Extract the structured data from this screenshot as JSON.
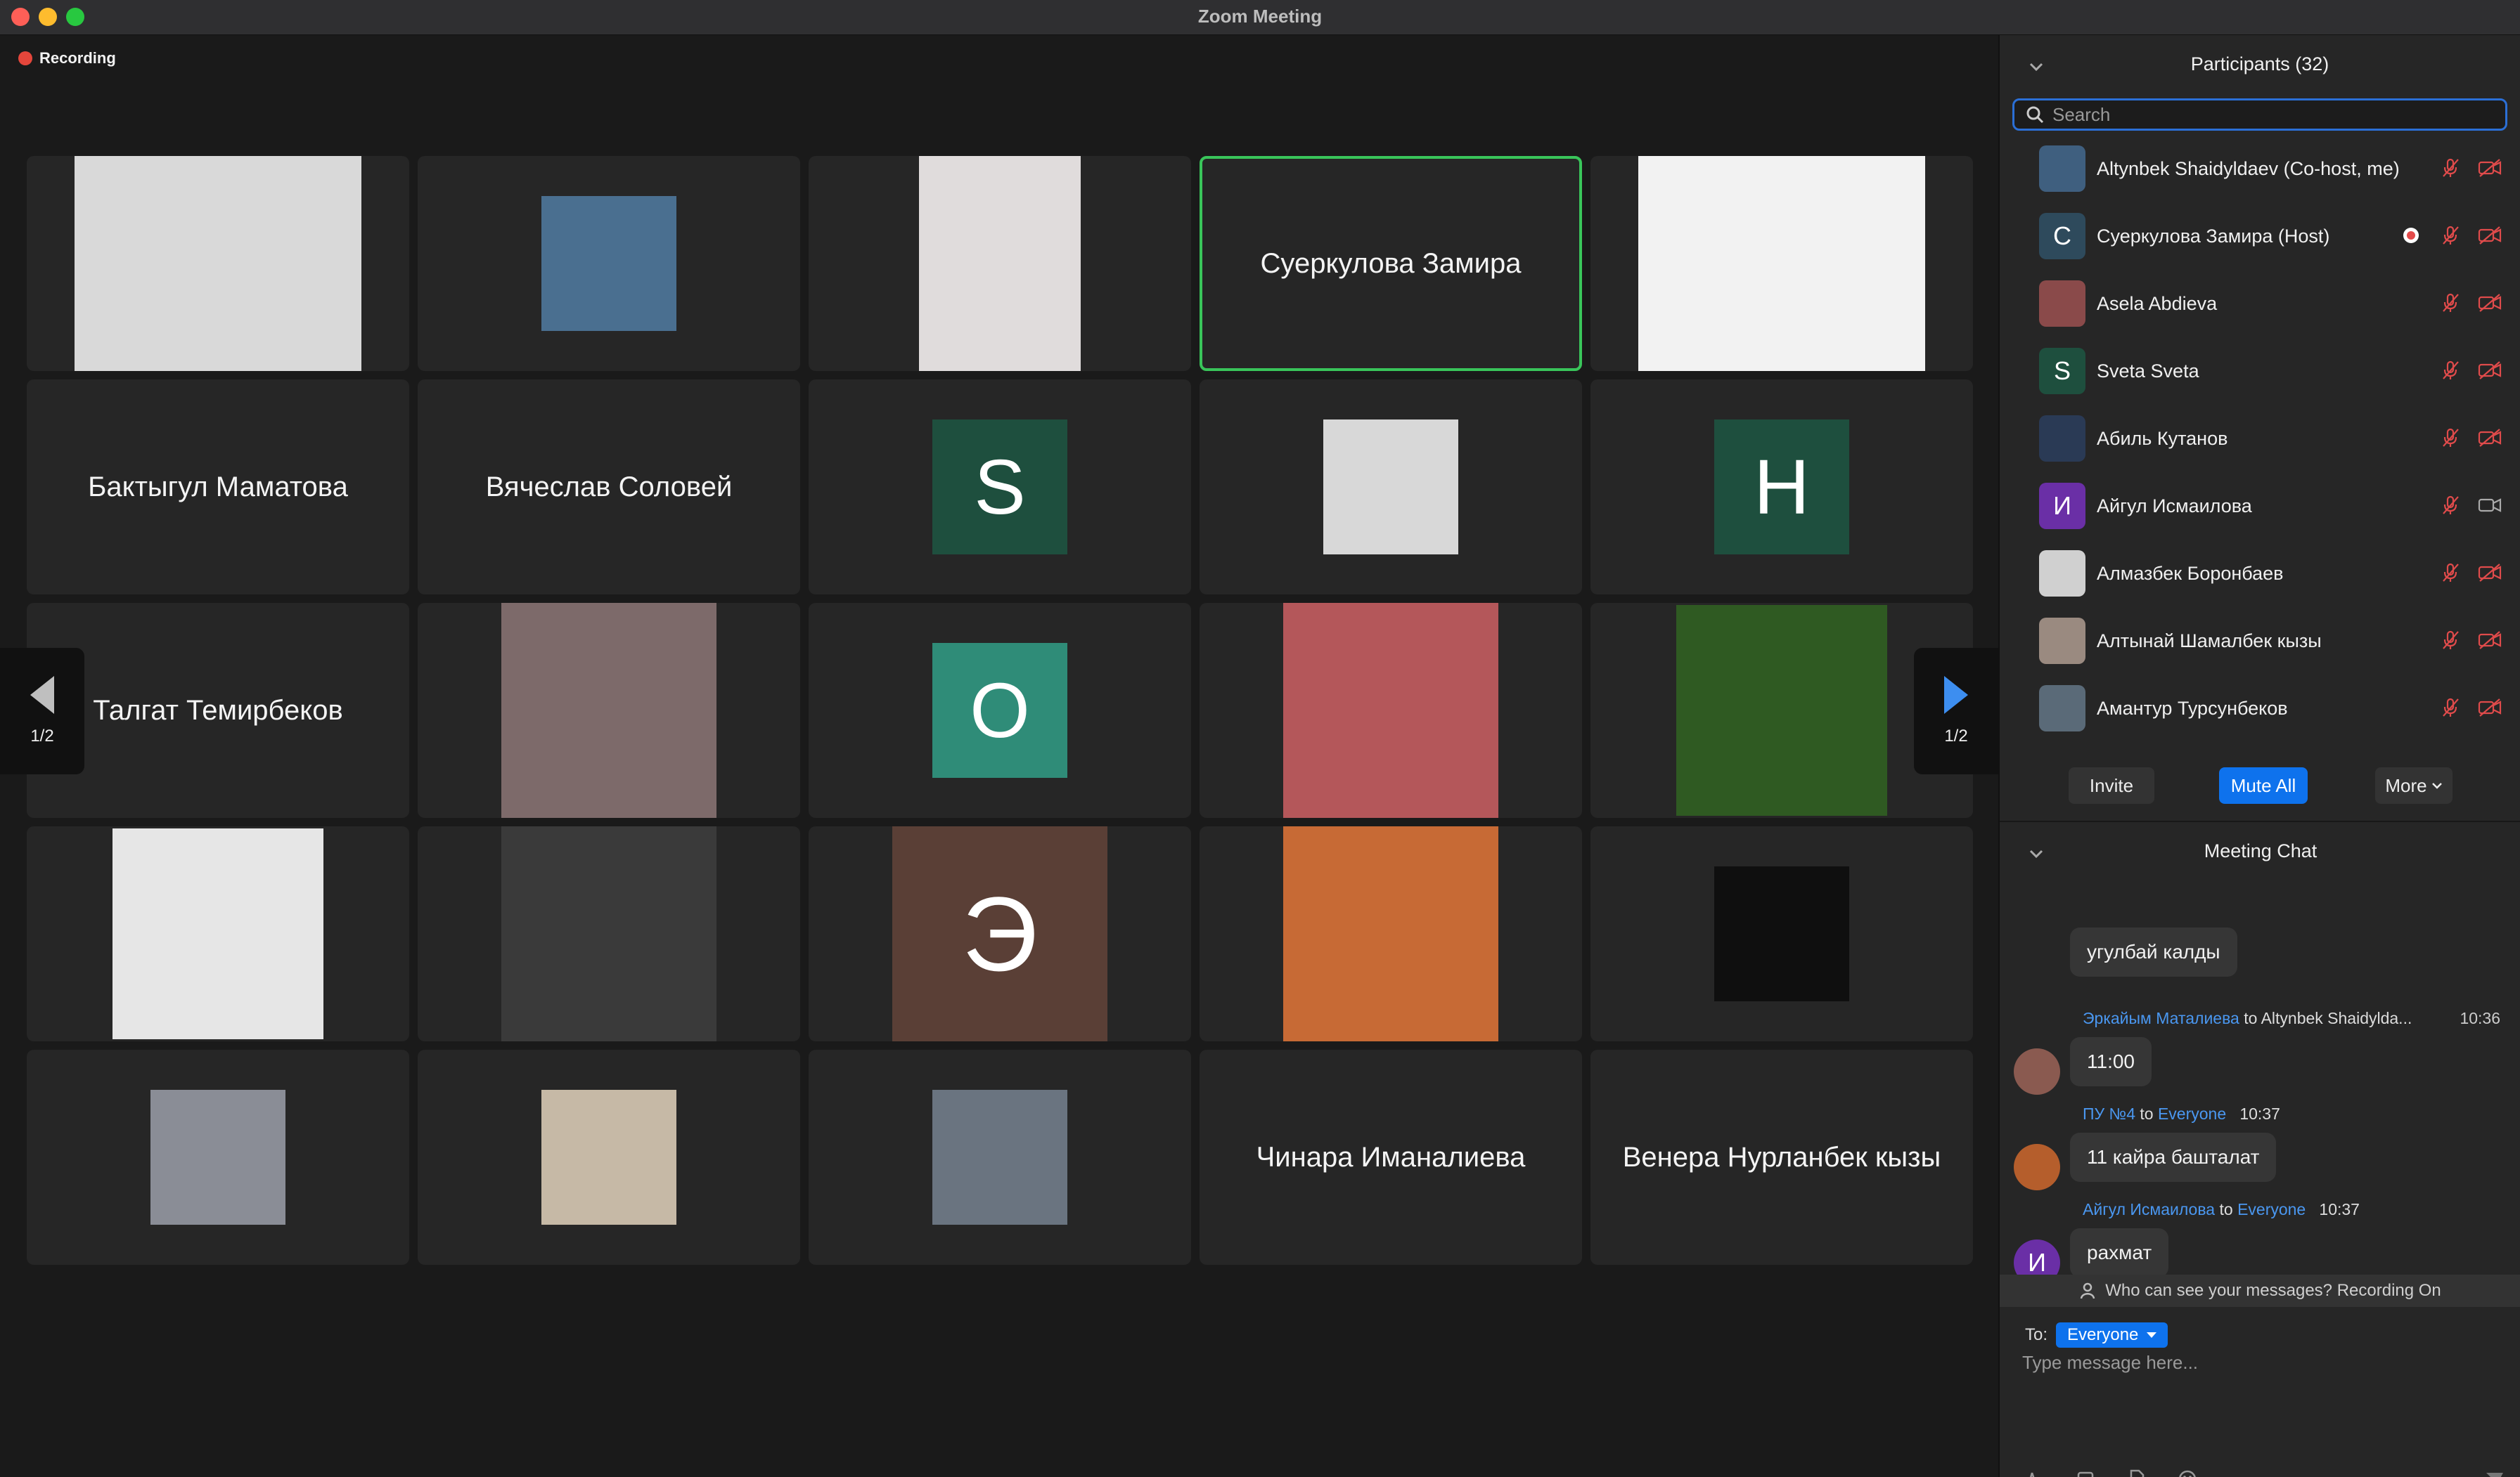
{
  "window": {
    "title": "Zoom Meeting"
  },
  "recording": {
    "label": "Recording"
  },
  "tiles": [
    {
      "kind": "photo",
      "size": "w408",
      "fill": "#d9d9d9"
    },
    {
      "kind": "photo",
      "size": "w190",
      "fill": "#4a6f90"
    },
    {
      "kind": "photo",
      "size": "w230",
      "fill": "#e0dcdc"
    },
    {
      "kind": "name",
      "label": "Суеркулова Замира",
      "active": true
    },
    {
      "kind": "photo",
      "size": "w408",
      "fill": "#f2f2f2"
    },
    {
      "kind": "name",
      "label": "Бактыгул Маматова"
    },
    {
      "kind": "name",
      "label": "Вячеслав Соловей"
    },
    {
      "kind": "initial",
      "label": "S",
      "color": "#1e4f3e"
    },
    {
      "kind": "photo",
      "size": "w190",
      "fill": "#d8d8d8"
    },
    {
      "kind": "initial",
      "label": "H",
      "color": "#1e4f3e"
    },
    {
      "kind": "name",
      "label": "Талгат Темирбеков"
    },
    {
      "kind": "photo",
      "size": "w306",
      "fill": "#7d6a6a"
    },
    {
      "kind": "initial",
      "label": "O",
      "color": "#2f8c78"
    },
    {
      "kind": "photo",
      "size": "w306",
      "fill": "#b4575a"
    },
    {
      "kind": "photo",
      "size": "w300",
      "fill": "#2f5a22"
    },
    {
      "kind": "photo",
      "size": "w300",
      "fill": "#e6e6e6"
    },
    {
      "kind": "photo",
      "size": "w306",
      "fill": "#3a3a3a"
    },
    {
      "kind": "initial-big",
      "label": "Э",
      "color": "#5a3f36"
    },
    {
      "kind": "photo",
      "size": "w306",
      "fill": "#c76a35"
    },
    {
      "kind": "photo",
      "size": "w190",
      "fill": "#0f0f0f"
    },
    {
      "kind": "photo",
      "size": "w190",
      "fill": "#8a8d96"
    },
    {
      "kind": "photo",
      "size": "w190",
      "fill": "#c6b9a6"
    },
    {
      "kind": "photo",
      "size": "w190",
      "fill": "#6a7480"
    },
    {
      "kind": "name",
      "label": "Чинара Иманалиева"
    },
    {
      "kind": "name",
      "label": "Венера Нурланбек кызы"
    }
  ],
  "pager": {
    "left_label": "1/2",
    "right_label": "1/2"
  },
  "participants": {
    "title": "Participants (32)",
    "search_placeholder": "Search",
    "items": [
      {
        "name": "Altynbek Shaidyldaev (Co-host, me)",
        "avatar": "#3f5f7f",
        "initial": "",
        "recording": false,
        "video_on": false
      },
      {
        "name": "Суеркулова Замира (Host)",
        "avatar": "#2e4a5c",
        "initial": "С",
        "recording": true,
        "video_on": false
      },
      {
        "name": "Asela Abdieva",
        "avatar": "#8a4a4a",
        "initial": "",
        "recording": false,
        "video_on": false
      },
      {
        "name": "Sveta Sveta",
        "avatar": "#1e4f3e",
        "initial": "S",
        "recording": false,
        "video_on": false
      },
      {
        "name": "Абиль Кутанов",
        "avatar": "#2a3a55",
        "initial": "",
        "recording": false,
        "video_on": false
      },
      {
        "name": "Айгул Исмаилова",
        "avatar": "#6a2fa6",
        "initial": "И",
        "recording": false,
        "video_on": true
      },
      {
        "name": "Алмазбек Боронбаев",
        "avatar": "#d0d0d0",
        "initial": "",
        "recording": false,
        "video_on": false
      },
      {
        "name": "Алтынай Шамалбек кызы",
        "avatar": "#9a8a80",
        "initial": "",
        "recording": false,
        "video_on": false
      },
      {
        "name": "Амантур Турсунбеков",
        "avatar": "#5a6a78",
        "initial": "",
        "recording": false,
        "video_on": false
      }
    ],
    "buttons": {
      "invite": "Invite",
      "mute_all": "Mute All",
      "more": "More"
    }
  },
  "chat": {
    "title": "Meeting Chat",
    "first_bubble": "угулбай калды",
    "messages": [
      {
        "sender": "Эркайым Маталиева",
        "to_word": "to",
        "recipient": "Altynbek Shaidylda...",
        "time": "10:36",
        "text": "11:00",
        "avatar": "#8a5a50",
        "initial": ""
      },
      {
        "sender": "ПУ №4",
        "to_word": "to",
        "recipient": "Everyone",
        "time": "10:37",
        "text": "11 кайра башталат",
        "avatar": "#b55e2c",
        "initial": ""
      },
      {
        "sender": "Айгул Исмаилова",
        "to_word": "to",
        "recipient": "Everyone",
        "time": "10:37",
        "text": "рахмат",
        "avatar": "#6a2fa6",
        "initial": "И"
      }
    ],
    "notice": "Who can see your messages? Recording On",
    "to_label": "To:",
    "to_value": "Everyone",
    "input_placeholder": "Type message here..."
  }
}
